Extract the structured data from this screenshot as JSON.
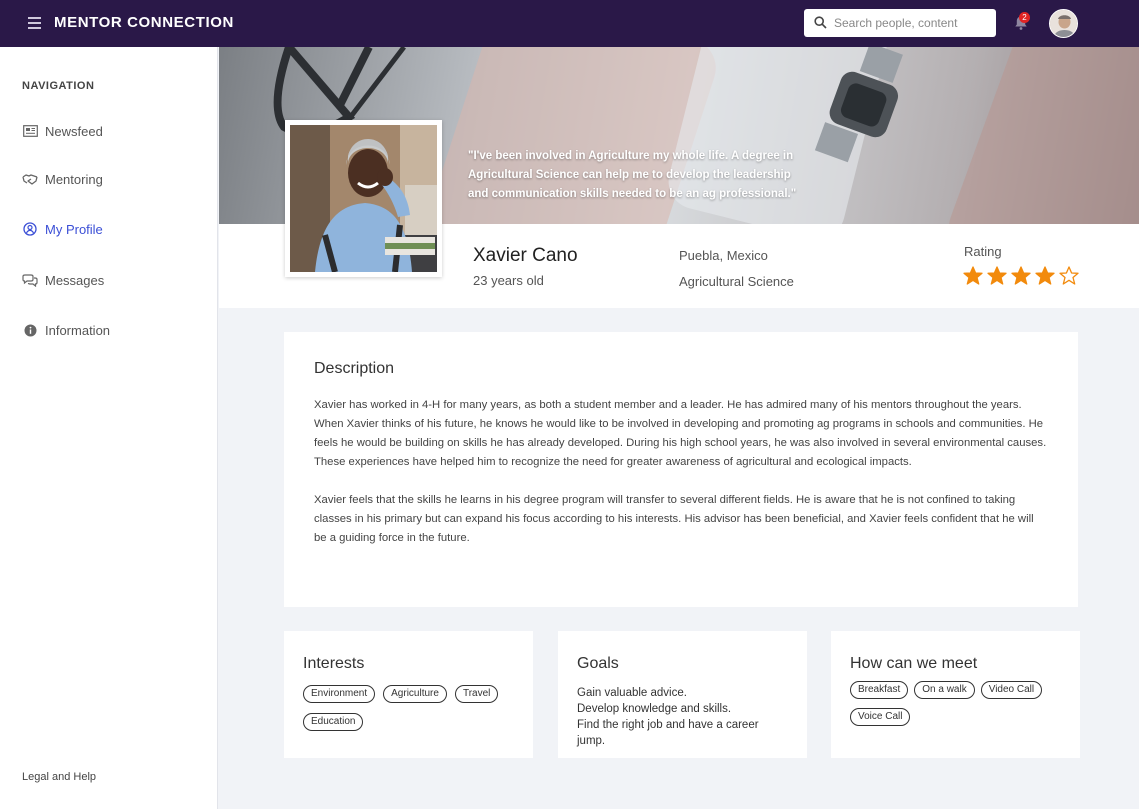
{
  "header": {
    "app_title": "MENTOR CONNECTION",
    "search_placeholder": "Search people, content",
    "notification_count": "2"
  },
  "sidebar": {
    "heading": "NAVIGATION",
    "items": [
      {
        "label": "Newsfeed",
        "icon": "newspaper-icon",
        "active": false
      },
      {
        "label": "Mentoring",
        "icon": "handshake-icon",
        "active": false
      },
      {
        "label": "My Profile",
        "icon": "user-circle-icon",
        "active": true
      },
      {
        "label": "Messages",
        "icon": "chat-bubbles-icon",
        "active": false
      },
      {
        "label": "Information",
        "icon": "info-icon",
        "active": false
      }
    ],
    "footer_link": "Legal and Help",
    "active_color": "#3b4fd6"
  },
  "banner": {
    "quote": "\"I've been involved in Agriculture my whole life.  A degree in Agricultural Science can help me to develop the leadership and communication skills needed to be an ag professional.\""
  },
  "profile": {
    "name": "Xavier Cano",
    "age": "23 years old",
    "location": "Puebla, Mexico",
    "field": "Agricultural Science",
    "rating_label": "Rating",
    "rating": 4,
    "rating_max": 5,
    "star_color": "#f28a0c"
  },
  "description": {
    "title": "Description",
    "paragraphs": [
      "Xavier has worked in 4-H for many years, as both a student member and a leader. He has admired many of his mentors throughout the years.  When Xavier thinks of his future, he knows he would like to be involved in developing and promoting ag programs in schools and communities.  He feels he would be building on skills he has already developed.  During his high school years, he was also involved in several environmental causes.  These experiences have helped him to recognize the need for greater awareness of agricultural and ecological impacts.",
      "Xavier feels that the skills he learns in his degree program will transfer to several different fields.  He is aware that he is not confined to taking classes in his primary but can expand his focus according to his interests. His advisor has been beneficial, and Xavier feels confident that he will be a guiding force in the future."
    ]
  },
  "interests": {
    "title": "Interests",
    "tags": [
      "Environment",
      "Agriculture",
      "Travel",
      "Education"
    ]
  },
  "goals": {
    "title": "Goals",
    "items": [
      "Gain valuable advice.",
      "Develop knowledge and skills.",
      "Find the right job and have a career jump."
    ]
  },
  "meet": {
    "title": "How can we meet",
    "tags": [
      "Breakfast",
      "On a walk",
      "Video Call",
      "Voice Call"
    ]
  },
  "colors": {
    "topbar": "#2a1848",
    "page_bg": "#f1f3f7"
  }
}
